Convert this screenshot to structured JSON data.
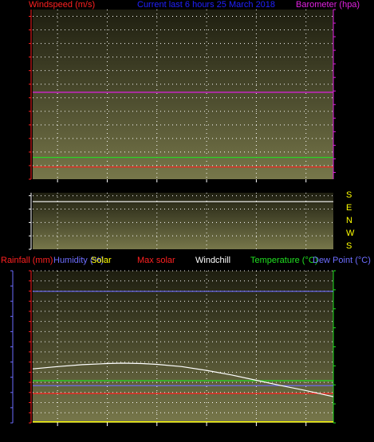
{
  "header_top": {
    "windspeed": "Windspeed (m/s)",
    "current": "Current last 6 hours 25 March 2018",
    "barometer": "Barometer (hpa)"
  },
  "header_bottom": {
    "rainfall": "Rainfall (mm)",
    "humidity": "Humidity (%)",
    "solar": "Solar",
    "max_solar": "Max solar",
    "windchill": "Windchill",
    "temperature": "Temperature (°C)",
    "dew_point": "Dew Point (°C)"
  },
  "compass": [
    "S",
    "E",
    "N",
    "W",
    "S"
  ],
  "colors": {
    "wind": "#ff2020",
    "baro": "#e020e0",
    "current": "#2020ff",
    "gust": "#20e020",
    "humidity": "#6d6dff",
    "rain": "#ff2020",
    "temperature": "#20e020",
    "windchill": "#ffffff",
    "dew": "#6d6dff",
    "solar": "#ffff00",
    "axis_temp": "#20e020"
  },
  "chart_data": [
    {
      "type": "line",
      "x_ticks": [
        "12",
        "13",
        "14",
        "15",
        "16",
        "17"
      ],
      "x_range": [
        11.5,
        17.55
      ],
      "y_left": {
        "label": "Windspeed (m/s)",
        "ticks": [
          0,
          2,
          4,
          6,
          8,
          10,
          12,
          14,
          16,
          18,
          20,
          22,
          24
        ],
        "range": [
          0,
          25
        ]
      },
      "y_right": {
        "label": "Barometer (hpa)",
        "ticks": [
          975,
          980,
          985,
          990,
          995,
          1000,
          1005,
          1010,
          1015,
          1020,
          1025,
          1030,
          1035
        ],
        "range": [
          972.5,
          1035
        ]
      },
      "series": [
        {
          "name": "Barometer (hpa)",
          "axis": "right",
          "color": "#e020e0",
          "x": [
            11.5,
            17.55
          ],
          "y": [
            1004.5,
            1004.5
          ]
        },
        {
          "name": "Windspeed (m/s)",
          "axis": "left",
          "color": "#ff2020",
          "x": [
            11.5,
            17.55
          ],
          "y": [
            1.8,
            1.8
          ]
        },
        {
          "axis": "left",
          "color": "#20e020",
          "x": [
            11.5,
            17.55
          ],
          "y": [
            3.2,
            3.2
          ]
        }
      ]
    },
    {
      "type": "line",
      "x_range": [
        11.5,
        17.55
      ],
      "y_left": {
        "ticks": [
          0,
          90,
          180,
          270,
          360
        ],
        "range": [
          0,
          380
        ]
      },
      "series": [
        {
          "color": "#ffffff",
          "x": [
            11.5,
            17.55
          ],
          "y": [
            320,
            320
          ]
        }
      ]
    },
    {
      "type": "line",
      "x_ticks": [
        "12",
        "13",
        "14",
        "15",
        "16",
        "17"
      ],
      "x_range": [
        11.5,
        17.55
      ],
      "y_humidity": {
        "ticks": [
          0,
          10,
          20,
          30,
          40,
          50,
          60,
          70,
          80,
          90,
          100
        ],
        "range": [
          0,
          100
        ]
      },
      "y_rain": {
        "ticks": [
          0,
          2,
          4,
          6,
          8,
          10,
          12,
          14,
          16,
          18,
          20,
          22,
          24,
          26,
          28,
          30
        ],
        "range": [
          0,
          30
        ]
      },
      "y_temp": {
        "ticks": [
          -10,
          -5,
          0,
          5,
          10,
          15,
          20,
          25,
          30
        ],
        "range": [
          -10,
          30
        ]
      },
      "series": [
        {
          "name": "Humidity (%)",
          "axis": "humidity",
          "color": "#6d6dff",
          "x": [
            11.5,
            17.55
          ],
          "y": [
            86.5,
            86.5
          ]
        },
        {
          "name": "Rainfall (mm)",
          "axis": "rain",
          "color": "#ff2020",
          "x": [
            11.5,
            17.55
          ],
          "y": [
            5.8,
            5.8
          ]
        },
        {
          "name": "Temperature (°C)",
          "axis": "temp",
          "color": "#20e020",
          "x": [
            11.5,
            17.55
          ],
          "y": [
            1.1,
            1.1
          ]
        },
        {
          "name": "Dew Point (°C)",
          "axis": "temp",
          "color": "#6d6dff",
          "x": [
            11.5,
            17.55
          ],
          "y": [
            -0.2,
            -0.2
          ]
        },
        {
          "name": "Windchill",
          "axis": "temp",
          "color": "#ffffff",
          "x": [
            11.5,
            12,
            12.5,
            13,
            13.3,
            13.7,
            14,
            14.5,
            15,
            15.5,
            16,
            16.5,
            17,
            17.55
          ],
          "y": [
            4.2,
            4.8,
            5.3,
            5.6,
            5.7,
            5.6,
            5.4,
            4.8,
            3.8,
            2.6,
            1.2,
            -0.2,
            -1.5,
            -3.1
          ]
        },
        {
          "name": "Solar",
          "axis": "temp",
          "color": "#ffff00",
          "x": [
            11.5,
            17.55
          ],
          "y": [
            -9.7,
            -9.7
          ]
        }
      ]
    }
  ]
}
